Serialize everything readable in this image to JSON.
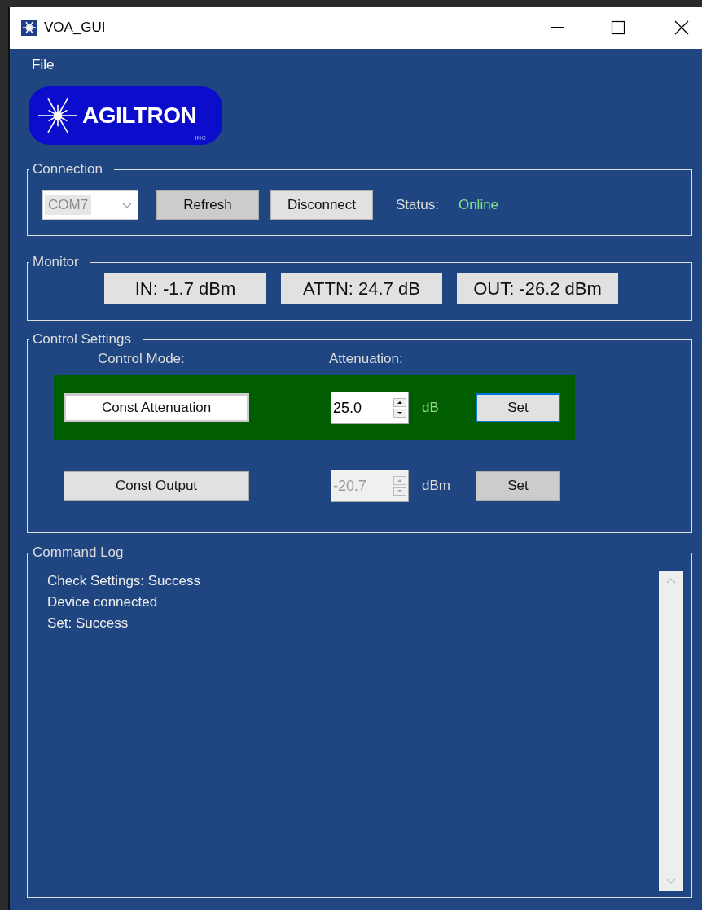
{
  "window": {
    "title": "VOA_GUI"
  },
  "menu": [
    "File"
  ],
  "logo": {
    "name": "AGILTRON",
    "suffix": "INC"
  },
  "connection": {
    "title": "Connection",
    "port": {
      "value": "COM7",
      "disabled": true
    },
    "buttons": [
      {
        "label": "Refresh",
        "kind": "plain"
      },
      {
        "label": "Disconnect",
        "kind": "raised"
      }
    ],
    "status_label": "Status:",
    "status": "Online"
  },
  "monitor": {
    "title": "Monitor",
    "readouts": [
      "IN: -1.7 dBm",
      "ATTN: 24.7 dB",
      "OUT: -26.2 dBm"
    ]
  },
  "control": {
    "title": "Control Settings",
    "mode_label": "Control Mode:",
    "value_label": "Attenuation:",
    "modes": [
      {
        "label": "Const Attenuation",
        "selected": true,
        "value": "25.0",
        "unit": "dB",
        "button": "Set"
      },
      {
        "label": "Const Output",
        "selected": false,
        "value": "-20.7",
        "unit": "dBm",
        "button": "Set"
      }
    ]
  },
  "log": {
    "title": "Command Log",
    "lines": [
      "Check Settings: Success",
      "Device connected",
      "Set: Success"
    ]
  }
}
